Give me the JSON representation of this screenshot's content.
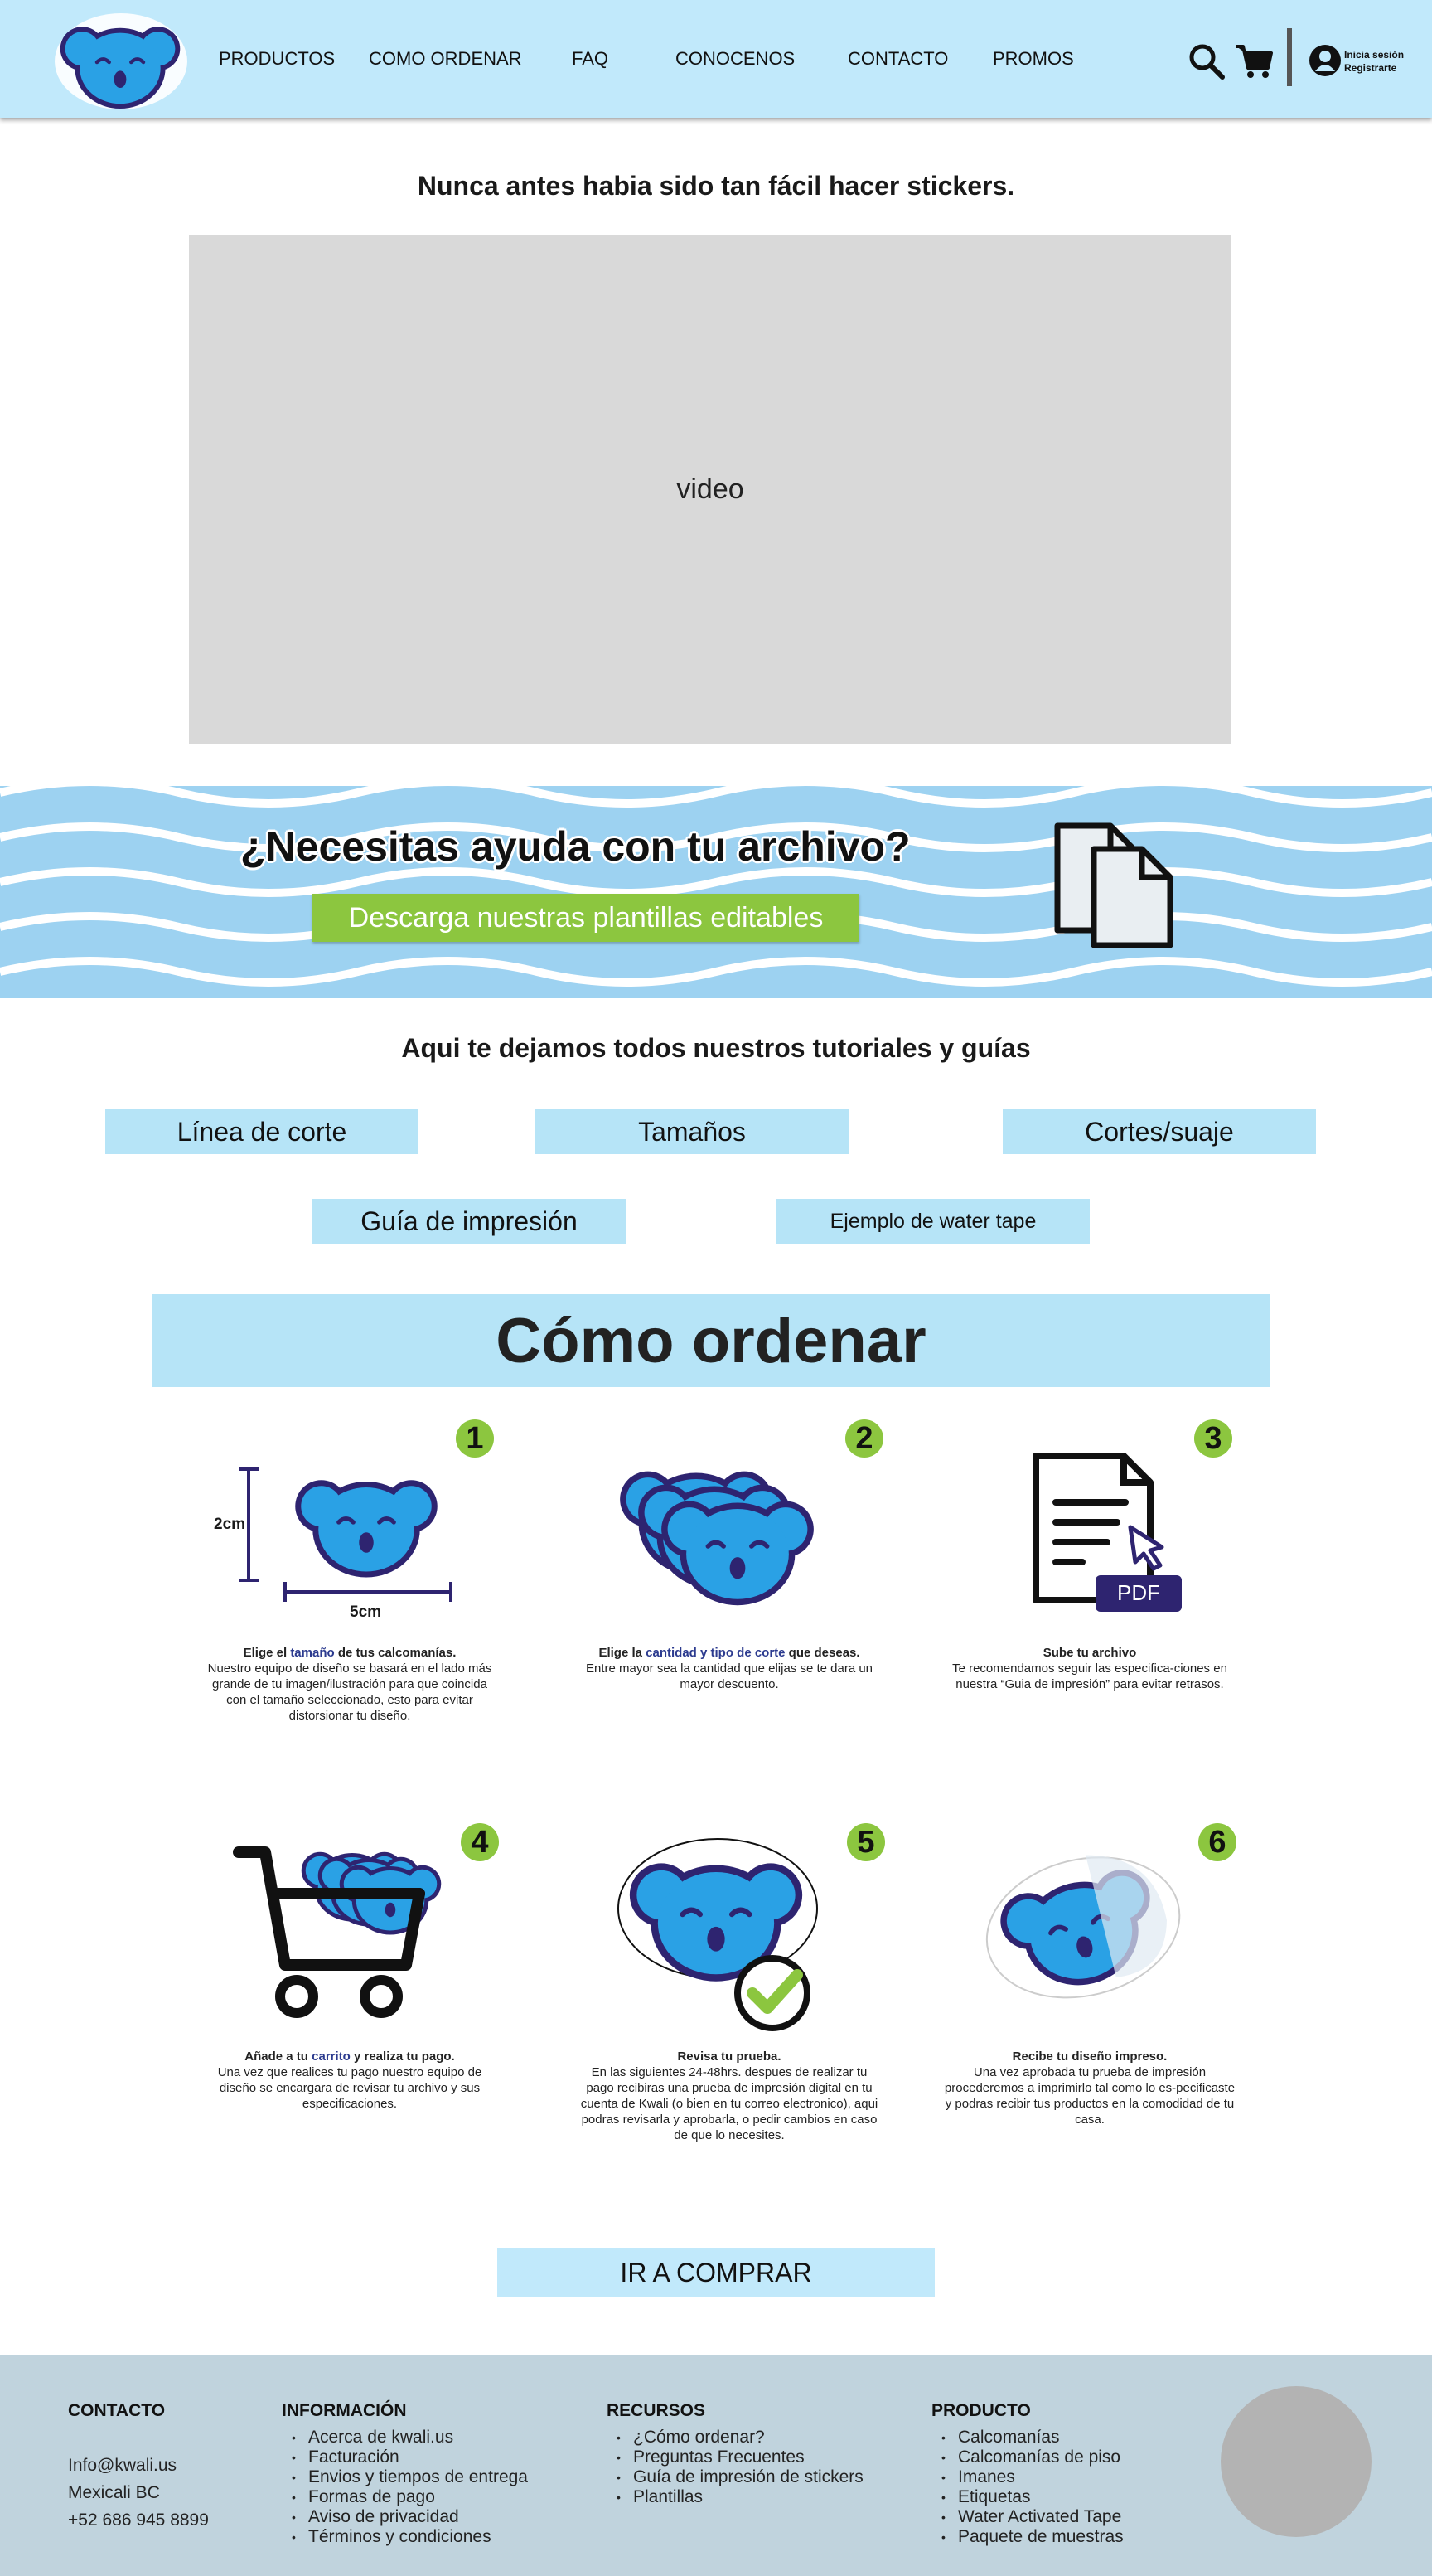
{
  "header": {
    "nav": [
      "PRODUCTOS",
      "COMO ORDENAR",
      "FAQ",
      "CONOCENOS",
      "CONTACTO",
      "PROMOS"
    ],
    "login": "Inicia sesión",
    "register": "Registrarte",
    "logo_icon": "koala-logo",
    "icons": [
      "search-icon",
      "cart-icon",
      "user-icon"
    ],
    "bg_color": "#c1e9fb"
  },
  "hero": {
    "tagline": "Nunca antes habia sido tan fácil hacer stickers.",
    "video_label": "video"
  },
  "banner": {
    "question": "¿Necesitas ayuda con tu archivo?",
    "button": "Descarga nuestras plantillas editables",
    "button_color": "#8cc63f",
    "wave_color": "#9dd2f1"
  },
  "tutorials": {
    "title": "Aqui te dejamos todos nuestros tutoriales y guías",
    "buttons": [
      "Línea de corte",
      "Tamaños",
      "Cortes/suaje",
      "Guía de impresión",
      "Ejemplo de water tape"
    ]
  },
  "how_to": {
    "title": "Cómo ordenar",
    "size_dims": {
      "height": "2cm",
      "width": "5cm"
    },
    "pdf_label": "PDF",
    "steps": [
      {
        "num": "1",
        "title_a": "Elige el ",
        "title_hl": "tamaño",
        "title_b": " de tus calcomanías.",
        "body": "Nuestro equipo de diseño se basará en el lado más grande de tu imagen/ilustración para que coincida con el tamaño seleccionado, esto para evitar distorsionar tu diseño."
      },
      {
        "num": "2",
        "title_a": "Elige la ",
        "title_hl": "cantidad y tipo de corte",
        "title_b": " que deseas.",
        "body": "Entre mayor sea la cantidad que elijas se te dara un mayor descuento."
      },
      {
        "num": "3",
        "title_a": "Sube tu archivo",
        "title_hl": "",
        "title_b": "",
        "body": "Te recomendamos seguir las especifica-ciones en nuestra “Guia de impresión” para evitar retrasos."
      },
      {
        "num": "4",
        "title_a": "Añade a tu ",
        "title_hl": "carrito",
        "title_b": " y realiza tu pago.",
        "body": "Una vez que realices tu pago nuestro equipo de diseño se encargara de revisar tu archivo y sus especificaciones."
      },
      {
        "num": "5",
        "title_a": "Revisa tu prueba.",
        "title_hl": "",
        "title_b": "",
        "body": "En las siguientes 24-48hrs. despues de realizar tu pago recibiras una prueba de impresión digital en tu cuenta de Kwali (o bien en tu correo electronico), aqui podras revisarla y aprobarla, o pedir cambios en caso de que lo necesites."
      },
      {
        "num": "6",
        "title_a": "Recibe tu diseño impreso.",
        "title_hl": "",
        "title_b": "",
        "body": "Una vez aprobada tu prueba de impresión procederemos a imprimirlo tal como lo es-pecificaste y podras recibir tus productos en la comodidad de tu casa."
      }
    ],
    "buy_button": "IR A COMPRAR"
  },
  "footer": {
    "contact_title": "CONTACTO",
    "contact": [
      "Info@kwali.us",
      "Mexicali BC",
      "+52 686 945 8899"
    ],
    "info_title": "INFORMACIÓN",
    "info": [
      "Acerca de kwali.us",
      "Facturación",
      "Envios y tiempos de entrega",
      "Formas de pago",
      "Aviso de privacidad",
      "Términos y condiciones"
    ],
    "resources_title": "RECURSOS",
    "resources": [
      "¿Cómo ordenar?",
      "Preguntas Frecuentes",
      "Guía de impresión de stickers",
      "Plantillas"
    ],
    "product_title": "PRODUCTO",
    "product": [
      "Calcomanías",
      "Calcomanías de piso",
      "Imanes",
      "Etiquetas",
      "Water Activated Tape",
      "Paquete de muestras"
    ],
    "bg_color": "#c0d3dd"
  }
}
